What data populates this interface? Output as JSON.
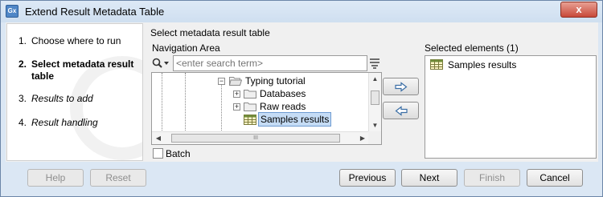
{
  "window": {
    "title": "Extend Result Metadata Table",
    "app_icon": "Gx",
    "close_icon": "x"
  },
  "steps": [
    {
      "num": "1.",
      "label": "Choose where to run",
      "state": "done"
    },
    {
      "num": "2.",
      "label": "Select metadata result table",
      "state": "active"
    },
    {
      "num": "3.",
      "label": "Results to add",
      "state": "pending"
    },
    {
      "num": "4.",
      "label": "Result handling",
      "state": "pending"
    }
  ],
  "main": {
    "section_title": "Select metadata result table",
    "nav_label": "Navigation Area",
    "search_placeholder": "<enter search term>",
    "tree": [
      {
        "label": "Typing tutorial",
        "icon": "folder-open-icon",
        "expander": "−"
      },
      {
        "label": "Databases",
        "icon": "folder-icon",
        "expander": "+"
      },
      {
        "label": "Raw reads",
        "icon": "folder-icon",
        "expander": "+"
      },
      {
        "label": "Samples results",
        "icon": "table-icon",
        "selected": true
      }
    ],
    "hscroll_grip": "III",
    "batch_label": "Batch"
  },
  "selected": {
    "title": "Selected elements (1)",
    "items": [
      {
        "label": "Samples results",
        "icon": "table-icon"
      }
    ]
  },
  "footer": {
    "help": "Help",
    "reset": "Reset",
    "previous": "Previous",
    "next": "Next",
    "finish": "Finish",
    "cancel": "Cancel"
  },
  "colors": {
    "accent": "#4f86c6",
    "selection": "#c5dcf5",
    "close": "#c8493a"
  }
}
